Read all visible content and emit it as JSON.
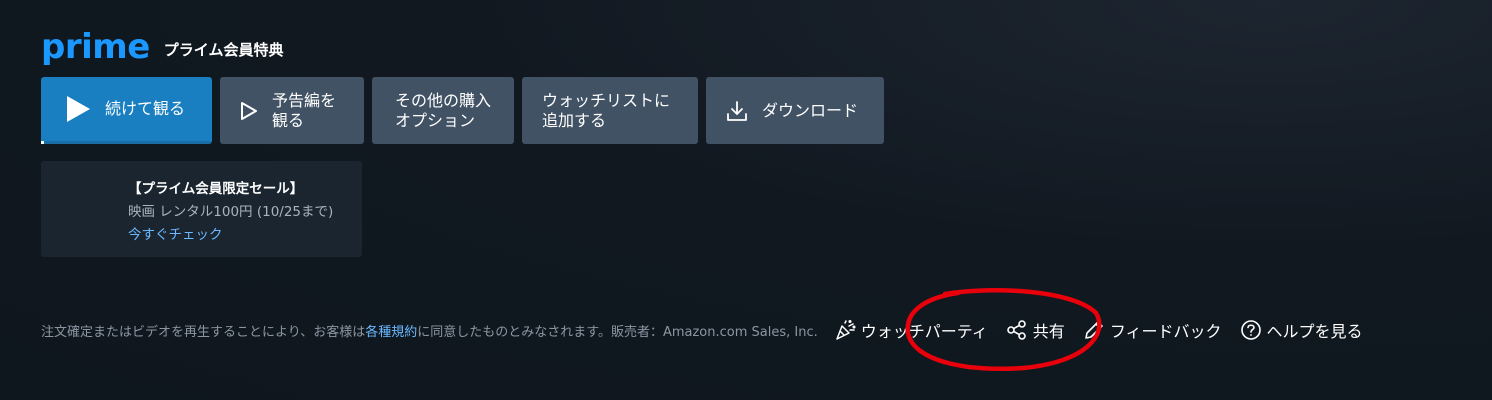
{
  "header": {
    "logo": "prime",
    "benefit_label": "プライム会員特典"
  },
  "actions": {
    "play": "続けて観る",
    "trailer_line1": "予告編を",
    "trailer_line2": "観る",
    "other_line1": "その他の購入",
    "other_line2": "オプション",
    "watchlist_line1": "ウォッチリストに",
    "watchlist_line2": "追加する",
    "download": "ダウンロード"
  },
  "promo": {
    "title": "【プライム会員限定セール】",
    "subtitle": "映画 レンタル100円 (10/25まで)",
    "link": "今すぐチェック"
  },
  "footer": {
    "legal_prefix": "注文確定またはビデオを再生することにより、お客様は",
    "legal_link": "各種規約",
    "legal_suffix": "に同意したものとみなされます。販売者：Amazon.com Sales, Inc.",
    "watch_party": "ウォッチパーティ",
    "share": "共有",
    "feedback": "フィードバック",
    "help": "ヘルプを見る"
  },
  "icons": {
    "play": "play-filled-icon",
    "trailer": "play-outline-icon",
    "download": "download-icon",
    "watch_party": "party-popper-icon",
    "share": "share-icon",
    "feedback": "pencil-icon",
    "help": "help-circle-icon"
  },
  "colors": {
    "background": "#0f171e",
    "brand": "#1a98ff",
    "primary_button": "#1a7fc1",
    "secondary_button": "#425265",
    "link": "#6ab8ff",
    "annotation": "#e8000b"
  }
}
